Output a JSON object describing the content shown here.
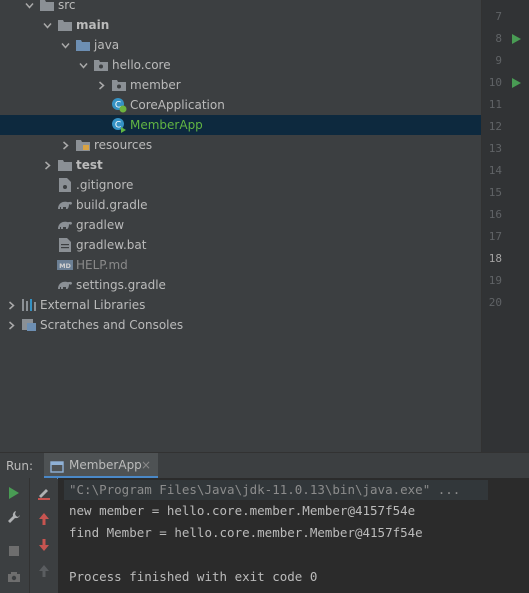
{
  "project_tree": {
    "items": [
      {
        "label": "src",
        "indent": 1,
        "arrow": "down",
        "icon": "folder-icon",
        "style": "normal"
      },
      {
        "label": "main",
        "indent": 2,
        "arrow": "down",
        "icon": "folder-icon",
        "style": "bold"
      },
      {
        "label": "java",
        "indent": 3,
        "arrow": "down",
        "icon": "source-folder-icon",
        "style": "normal"
      },
      {
        "label": "hello.core",
        "indent": 4,
        "arrow": "down",
        "icon": "package-icon",
        "style": "normal"
      },
      {
        "label": "member",
        "indent": 5,
        "arrow": "right",
        "icon": "package-icon",
        "style": "normal"
      },
      {
        "label": "CoreApplication",
        "indent": 5,
        "arrow": "none",
        "icon": "spring-class-icon",
        "style": "normal"
      },
      {
        "label": "MemberApp",
        "indent": 5,
        "arrow": "none",
        "icon": "class-icon",
        "style": "green",
        "selected": true
      },
      {
        "label": "resources",
        "indent": 3,
        "arrow": "right",
        "icon": "resources-folder-icon",
        "style": "normal"
      },
      {
        "label": "test",
        "indent": 2,
        "arrow": "right",
        "icon": "folder-icon",
        "style": "bold"
      },
      {
        "label": ".gitignore",
        "indent": 2,
        "arrow": "none",
        "icon": "gitignore-file-icon",
        "style": "normal"
      },
      {
        "label": "build.gradle",
        "indent": 2,
        "arrow": "none",
        "icon": "gradle-icon",
        "style": "normal"
      },
      {
        "label": "gradlew",
        "indent": 2,
        "arrow": "none",
        "icon": "gradle-icon",
        "style": "normal"
      },
      {
        "label": "gradlew.bat",
        "indent": 2,
        "arrow": "none",
        "icon": "text-file-icon",
        "style": "normal"
      },
      {
        "label": "HELP.md",
        "indent": 2,
        "arrow": "none",
        "icon": "markdown-file-icon",
        "style": "dim"
      },
      {
        "label": "settings.gradle",
        "indent": 2,
        "arrow": "none",
        "icon": "gradle-icon",
        "style": "normal"
      },
      {
        "label": "External Libraries",
        "indent": 0,
        "arrow": "right",
        "icon": "libraries-icon",
        "style": "normal"
      },
      {
        "label": "Scratches and Consoles",
        "indent": 0,
        "arrow": "right",
        "icon": "scratches-icon",
        "style": "normal"
      }
    ]
  },
  "gutter": {
    "line_numbers": [
      "7",
      "8",
      "9",
      "10",
      "11",
      "12",
      "13",
      "14",
      "15",
      "16",
      "17",
      "18",
      "19",
      "20"
    ],
    "current_line": "18",
    "run_markers": [
      "8",
      "10"
    ]
  },
  "run_panel": {
    "label": "Run:",
    "tab_label": "MemberApp",
    "tab_close": "×"
  },
  "console": {
    "command": "\"C:\\Program Files\\Java\\jdk-11.0.13\\bin\\java.exe\" ...",
    "lines": [
      "new member = hello.core.member.Member@4157f54e",
      "find Member = hello.core.member.Member@4157f54e",
      "",
      "Process finished with exit code 0"
    ]
  },
  "colors": {
    "accent_green": "#62b543",
    "selection": "#0d293e",
    "run_green": "#499c54",
    "stop_red": "#c75450"
  }
}
